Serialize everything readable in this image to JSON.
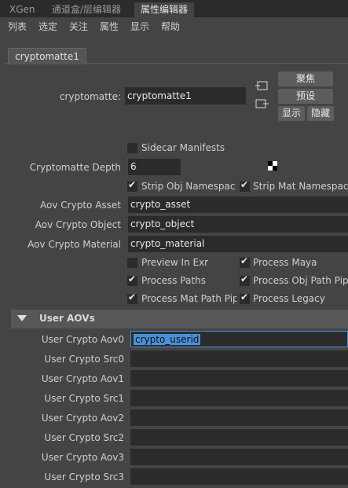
{
  "window_tabs": [
    "XGen",
    "通道盒/层编辑器",
    "属性编辑器"
  ],
  "menu": [
    "列表",
    "选定",
    "关注",
    "属性",
    "显示",
    "帮助"
  ],
  "node_tab": "cryptomatte1",
  "node_name_label": "cryptomatte:",
  "node_name_value": "cryptomatte1",
  "buttons": {
    "focus": "聚焦",
    "presets": "预设",
    "show": "显示",
    "hide": "隐藏"
  },
  "sidecar": {
    "label": "Sidecar Manifests",
    "checked": false
  },
  "depth": {
    "label": "Cryptomatte Depth",
    "value": "6"
  },
  "strip_obj": {
    "label": "Strip Obj Namespaces",
    "checked": true
  },
  "strip_mat": {
    "label": "Strip Mat Namespaces",
    "checked": true
  },
  "aov_asset": {
    "label": "Aov Crypto Asset",
    "value": "crypto_asset"
  },
  "aov_object": {
    "label": "Aov Crypto Object",
    "value": "crypto_object"
  },
  "aov_material": {
    "label": "Aov Crypto Material",
    "value": "crypto_material"
  },
  "checks": {
    "preview_in_exr": {
      "label": "Preview In Exr",
      "checked": false
    },
    "process_maya": {
      "label": "Process Maya",
      "checked": true
    },
    "process_paths": {
      "label": "Process Paths",
      "checked": true
    },
    "process_obj_path_pipes": {
      "label": "Process Obj Path Pipes",
      "checked": true
    },
    "process_mat_path_pipes": {
      "label": "Process Mat Path Pipes",
      "checked": true
    },
    "process_legacy": {
      "label": "Process Legacy",
      "checked": true
    }
  },
  "user_aovs": {
    "section_title": "User AOVs",
    "rows": [
      {
        "label": "User Crypto Aov0",
        "value": "crypto_userid"
      },
      {
        "label": "User Crypto Src0",
        "value": ""
      },
      {
        "label": "User Crypto Aov1",
        "value": ""
      },
      {
        "label": "User Crypto Src1",
        "value": ""
      },
      {
        "label": "User Crypto Aov2",
        "value": ""
      },
      {
        "label": "User Crypto Src2",
        "value": ""
      },
      {
        "label": "User Crypto Aov3",
        "value": ""
      },
      {
        "label": "User Crypto Src3",
        "value": ""
      }
    ]
  },
  "colors": {
    "background": "#444444",
    "field": "#2b2b2b",
    "highlight": "#4a90d9"
  }
}
